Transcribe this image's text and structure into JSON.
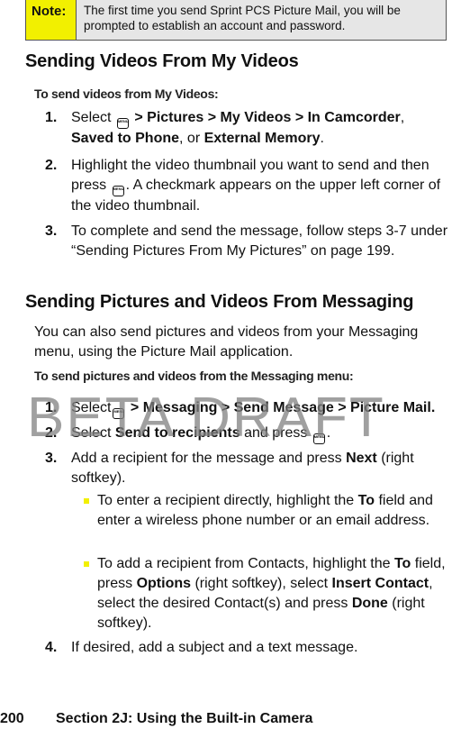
{
  "note": {
    "label": "Note:",
    "text": "The first time you send Sprint PCS Picture Mail, you will be prompted to establish an account and password."
  },
  "section1": {
    "heading": "Sending Videos From My Videos",
    "intro": "To send videos from My Videos:",
    "steps": [
      {
        "num": "1.",
        "parts": [
          "Select",
          "menu-ok-key-icon",
          " > Pictures > My Videos > In Camcorder",
          ", ",
          "Saved to Phone",
          ", or ",
          "External Memory",
          "."
        ]
      },
      {
        "num": "2.",
        "text_a": "Highlight the video thumbnail you want to send and then press",
        "text_b": ". A checkmark appears on the upper left corner of the video thumbnail."
      },
      {
        "num": "3.",
        "text": "To complete and send the message, follow steps 3-7 under “Sending Pictures From My Pictures” on page 199."
      }
    ]
  },
  "section2": {
    "heading": "Sending Pictures and Videos From Messaging",
    "paragraph": "You can also send pictures and videos from your Messaging menu, using the Picture Mail application.",
    "intro": "To send pictures and videos from the Messaging menu:",
    "steps": [
      {
        "num": "1.",
        "select": "Select",
        "path": " > Messaging > Send Message > Picture Mail."
      },
      {
        "num": "2.",
        "select": "Select ",
        "bold": "Send to recipients",
        "rest": " and press",
        "end": "."
      },
      {
        "num": "3.",
        "text": "Add a recipient for the message and press ",
        "bold": "Next",
        "rest": " (right softkey)."
      },
      {
        "num": "4.",
        "text": "If desired, add a subject and a text message."
      }
    ],
    "bullets": [
      {
        "a": "To enter a recipient directly, highlight the ",
        "b1": "To",
        "c": " field and enter a wireless phone number or an email address."
      },
      {
        "a": "To add a recipient from Contacts, highlight the ",
        "b1": "To",
        "c": " field, press ",
        "b2": "Options",
        "d": " (right softkey), select ",
        "b3": "Insert Contact",
        "e": ", select the desired Contact(s) and press ",
        "b4": "Done",
        "f": " (right softkey)."
      }
    ]
  },
  "key_icon": {
    "top": "MENU",
    "bottom": "OK"
  },
  "watermark": "BETA DRAFT",
  "footer": {
    "page": "200",
    "section": "Section 2J: Using the Built-in Camera"
  },
  "colors": {
    "note_label_bg": "#f2f000",
    "note_text_bg": "#e6e6e6",
    "bullet": "#f2f000"
  }
}
